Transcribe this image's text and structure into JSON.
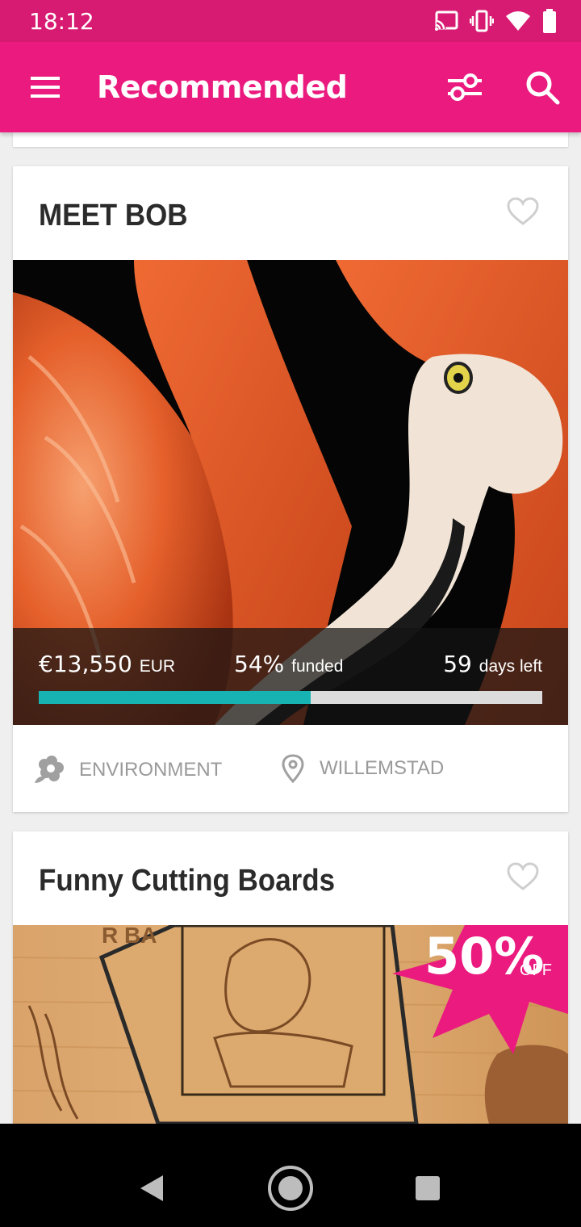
{
  "status_bar": {
    "time": "18:12",
    "icons": [
      "cast-icon",
      "vibrate-icon",
      "wifi-icon",
      "battery-icon"
    ]
  },
  "app_bar": {
    "title": "Recommended",
    "icons": [
      "menu-icon",
      "filter-icon",
      "search-icon"
    ],
    "background": "#ea1a7f"
  },
  "cards": [
    {
      "title": "MEET BOB",
      "image": "flamingo photo",
      "amount": "€13,550",
      "currency": "EUR",
      "percent": "54%",
      "percent_label": "funded",
      "progress": 0.54,
      "days": "59",
      "days_label": "days left",
      "category": "ENVIRONMENT",
      "location": "WILLEMSTAD"
    },
    {
      "title": "Funny Cutting Boards",
      "image": "cutting boards photo",
      "badge_number": "50%",
      "badge_label": "OFF"
    }
  ],
  "colors": {
    "accent": "#ea1a7f",
    "progress": "#17b3b3",
    "muted": "#9a9a9a"
  },
  "nav_bar": [
    "back-icon",
    "home-icon",
    "recents-icon"
  ]
}
